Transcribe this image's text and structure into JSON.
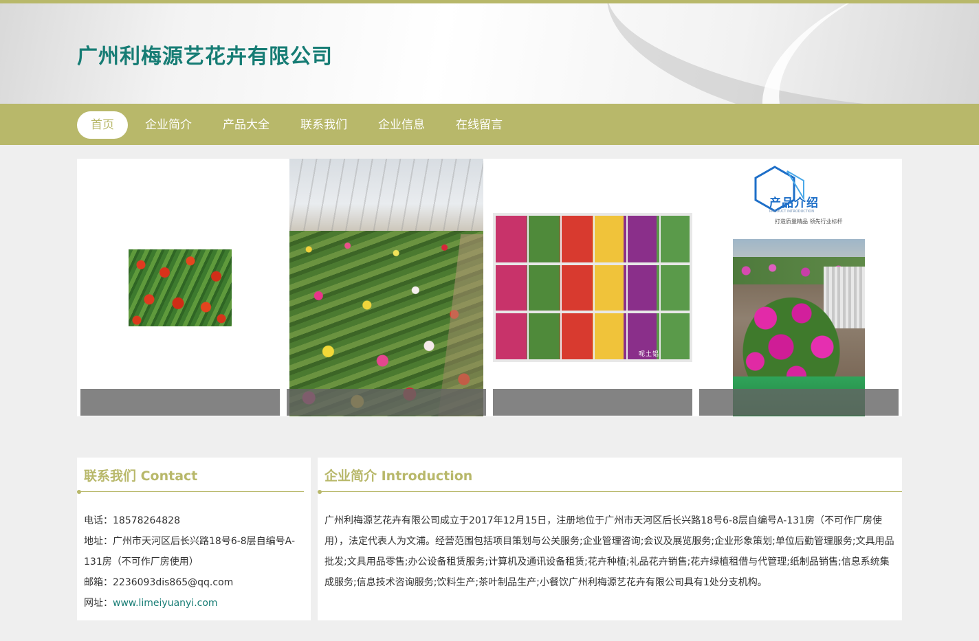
{
  "header": {
    "title": "广州利梅源艺花卉有限公司"
  },
  "nav": {
    "items": [
      {
        "label": "首页"
      },
      {
        "label": "企业简介"
      },
      {
        "label": "产品大全"
      },
      {
        "label": "联系我们"
      },
      {
        "label": "企业信息"
      },
      {
        "label": "在线留言"
      }
    ]
  },
  "gallery": {
    "product_badge": "产品介绍",
    "product_badge_sub": "PRODUCT INTRODUCTION",
    "product_badge_slogan": "打造质量精品 领先行业标杆",
    "watermark": "呢土铝"
  },
  "contact": {
    "title": "联系我们 Contact",
    "phone_label": "电话：",
    "phone": "18578264828",
    "address_label": "地址：",
    "address": "广州市天河区后长兴路18号6-8层自编号A-131房（不可作厂房使用）",
    "email_label": "邮箱：",
    "email": "2236093dis865@qq.com",
    "website_label": "网址：",
    "website": "www.limeiyuanyi.com"
  },
  "intro": {
    "title": "企业简介 Introduction",
    "text": "广州利梅源艺花卉有限公司成立于2017年12月15日，注册地位于广州市天河区后长兴路18号6-8层自编号A-131房（不可作厂房使用），法定代表人为文浦。经营范围包括项目策划与公关服务;企业管理咨询;会议及展览服务;企业形象策划;单位后勤管理服务;文具用品批发;文具用品零售;办公设备租赁服务;计算机及通讯设备租赁;花卉种植;礼品花卉销售;花卉绿植租借与代管理;纸制品销售;信息系统集成服务;信息技术咨询服务;饮料生产;茶叶制品生产;小餐饮广州利梅源艺花卉有限公司具有1处分支机构。"
  },
  "colors": {
    "accent": "#b8b86a",
    "title": "#167c74"
  }
}
